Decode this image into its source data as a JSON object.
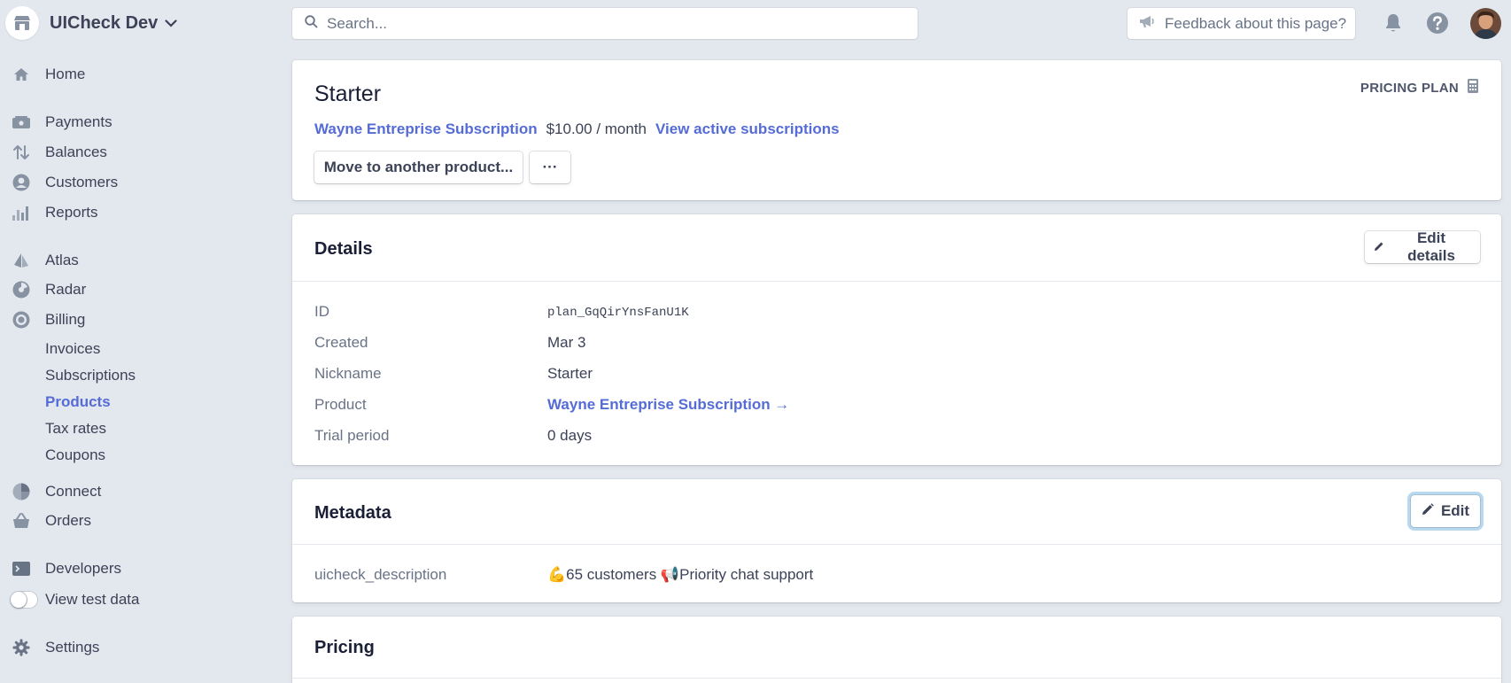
{
  "topbar": {
    "account_name": "UICheck Dev",
    "search_placeholder": "Search...",
    "feedback_label": "Feedback about this page?"
  },
  "sidebar": {
    "items": [
      {
        "label": "Home",
        "icon": "home-icon"
      },
      {
        "label": "Payments",
        "icon": "payments-icon"
      },
      {
        "label": "Balances",
        "icon": "balances-icon"
      },
      {
        "label": "Customers",
        "icon": "customers-icon"
      },
      {
        "label": "Reports",
        "icon": "reports-icon"
      },
      {
        "label": "Atlas",
        "icon": "atlas-icon"
      },
      {
        "label": "Radar",
        "icon": "radar-icon"
      },
      {
        "label": "Billing",
        "icon": "billing-icon"
      },
      {
        "label": "Invoices"
      },
      {
        "label": "Subscriptions"
      },
      {
        "label": "Products",
        "active": true
      },
      {
        "label": "Tax rates"
      },
      {
        "label": "Coupons"
      },
      {
        "label": "Connect",
        "icon": "connect-icon"
      },
      {
        "label": "Orders",
        "icon": "orders-icon"
      },
      {
        "label": "Developers",
        "icon": "developers-icon"
      },
      {
        "label": "View test data",
        "toggle": "off"
      },
      {
        "label": "Settings",
        "icon": "gear-icon"
      }
    ]
  },
  "plan": {
    "name": "Starter",
    "type_label": "PRICING PLAN",
    "product_link": "Wayne Entreprise Subscription",
    "price": "$10.00 / month",
    "view_subscriptions": "View active subscriptions",
    "move_button": "Move to another product...",
    "more_button": "···"
  },
  "details": {
    "title": "Details",
    "edit_button": "Edit details",
    "rows": [
      {
        "label": "ID",
        "value": "plan_GqQirYnsFanU1K"
      },
      {
        "label": "Created",
        "value": "Mar 3"
      },
      {
        "label": "Nickname",
        "value": "Starter"
      },
      {
        "label": "Product",
        "value": "Wayne Entreprise Subscription →"
      },
      {
        "label": "Trial period",
        "value": "0 days"
      }
    ]
  },
  "metadata": {
    "title": "Metadata",
    "edit_button": "Edit",
    "rows": [
      {
        "key": "uicheck_description",
        "value": "💪65 customers 📢Priority chat support"
      }
    ]
  },
  "pricing": {
    "title": "Pricing"
  },
  "colors": {
    "background": "#e3e8ee",
    "accent": "#556cd6",
    "text": "#3c4257",
    "muted": "#697386"
  }
}
